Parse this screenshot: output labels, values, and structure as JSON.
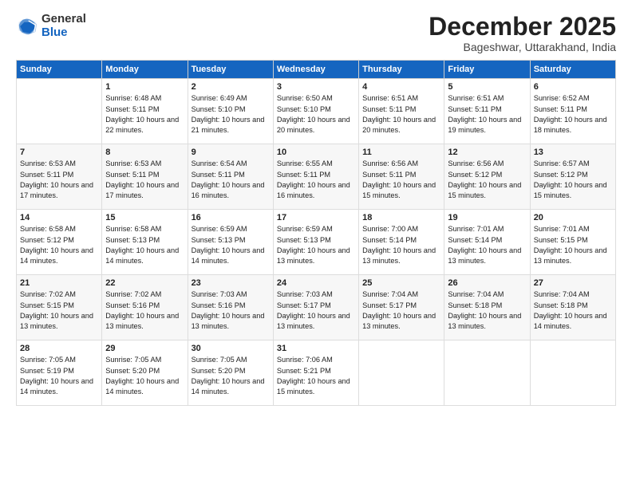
{
  "logo": {
    "general": "General",
    "blue": "Blue"
  },
  "header": {
    "title": "December 2025",
    "subtitle": "Bageshwar, Uttarakhand, India"
  },
  "days_of_week": [
    "Sunday",
    "Monday",
    "Tuesday",
    "Wednesday",
    "Thursday",
    "Friday",
    "Saturday"
  ],
  "weeks": [
    [
      {
        "day": "",
        "sunrise": "",
        "sunset": "",
        "daylight": "",
        "empty": true
      },
      {
        "day": "1",
        "sunrise": "Sunrise: 6:48 AM",
        "sunset": "Sunset: 5:11 PM",
        "daylight": "Daylight: 10 hours and 22 minutes."
      },
      {
        "day": "2",
        "sunrise": "Sunrise: 6:49 AM",
        "sunset": "Sunset: 5:10 PM",
        "daylight": "Daylight: 10 hours and 21 minutes."
      },
      {
        "day": "3",
        "sunrise": "Sunrise: 6:50 AM",
        "sunset": "Sunset: 5:10 PM",
        "daylight": "Daylight: 10 hours and 20 minutes."
      },
      {
        "day": "4",
        "sunrise": "Sunrise: 6:51 AM",
        "sunset": "Sunset: 5:11 PM",
        "daylight": "Daylight: 10 hours and 20 minutes."
      },
      {
        "day": "5",
        "sunrise": "Sunrise: 6:51 AM",
        "sunset": "Sunset: 5:11 PM",
        "daylight": "Daylight: 10 hours and 19 minutes."
      },
      {
        "day": "6",
        "sunrise": "Sunrise: 6:52 AM",
        "sunset": "Sunset: 5:11 PM",
        "daylight": "Daylight: 10 hours and 18 minutes."
      }
    ],
    [
      {
        "day": "7",
        "sunrise": "Sunrise: 6:53 AM",
        "sunset": "Sunset: 5:11 PM",
        "daylight": "Daylight: 10 hours and 17 minutes."
      },
      {
        "day": "8",
        "sunrise": "Sunrise: 6:53 AM",
        "sunset": "Sunset: 5:11 PM",
        "daylight": "Daylight: 10 hours and 17 minutes."
      },
      {
        "day": "9",
        "sunrise": "Sunrise: 6:54 AM",
        "sunset": "Sunset: 5:11 PM",
        "daylight": "Daylight: 10 hours and 16 minutes."
      },
      {
        "day": "10",
        "sunrise": "Sunrise: 6:55 AM",
        "sunset": "Sunset: 5:11 PM",
        "daylight": "Daylight: 10 hours and 16 minutes."
      },
      {
        "day": "11",
        "sunrise": "Sunrise: 6:56 AM",
        "sunset": "Sunset: 5:11 PM",
        "daylight": "Daylight: 10 hours and 15 minutes."
      },
      {
        "day": "12",
        "sunrise": "Sunrise: 6:56 AM",
        "sunset": "Sunset: 5:12 PM",
        "daylight": "Daylight: 10 hours and 15 minutes."
      },
      {
        "day": "13",
        "sunrise": "Sunrise: 6:57 AM",
        "sunset": "Sunset: 5:12 PM",
        "daylight": "Daylight: 10 hours and 15 minutes."
      }
    ],
    [
      {
        "day": "14",
        "sunrise": "Sunrise: 6:58 AM",
        "sunset": "Sunset: 5:12 PM",
        "daylight": "Daylight: 10 hours and 14 minutes."
      },
      {
        "day": "15",
        "sunrise": "Sunrise: 6:58 AM",
        "sunset": "Sunset: 5:13 PM",
        "daylight": "Daylight: 10 hours and 14 minutes."
      },
      {
        "day": "16",
        "sunrise": "Sunrise: 6:59 AM",
        "sunset": "Sunset: 5:13 PM",
        "daylight": "Daylight: 10 hours and 14 minutes."
      },
      {
        "day": "17",
        "sunrise": "Sunrise: 6:59 AM",
        "sunset": "Sunset: 5:13 PM",
        "daylight": "Daylight: 10 hours and 13 minutes."
      },
      {
        "day": "18",
        "sunrise": "Sunrise: 7:00 AM",
        "sunset": "Sunset: 5:14 PM",
        "daylight": "Daylight: 10 hours and 13 minutes."
      },
      {
        "day": "19",
        "sunrise": "Sunrise: 7:01 AM",
        "sunset": "Sunset: 5:14 PM",
        "daylight": "Daylight: 10 hours and 13 minutes."
      },
      {
        "day": "20",
        "sunrise": "Sunrise: 7:01 AM",
        "sunset": "Sunset: 5:15 PM",
        "daylight": "Daylight: 10 hours and 13 minutes."
      }
    ],
    [
      {
        "day": "21",
        "sunrise": "Sunrise: 7:02 AM",
        "sunset": "Sunset: 5:15 PM",
        "daylight": "Daylight: 10 hours and 13 minutes."
      },
      {
        "day": "22",
        "sunrise": "Sunrise: 7:02 AM",
        "sunset": "Sunset: 5:16 PM",
        "daylight": "Daylight: 10 hours and 13 minutes."
      },
      {
        "day": "23",
        "sunrise": "Sunrise: 7:03 AM",
        "sunset": "Sunset: 5:16 PM",
        "daylight": "Daylight: 10 hours and 13 minutes."
      },
      {
        "day": "24",
        "sunrise": "Sunrise: 7:03 AM",
        "sunset": "Sunset: 5:17 PM",
        "daylight": "Daylight: 10 hours and 13 minutes."
      },
      {
        "day": "25",
        "sunrise": "Sunrise: 7:04 AM",
        "sunset": "Sunset: 5:17 PM",
        "daylight": "Daylight: 10 hours and 13 minutes."
      },
      {
        "day": "26",
        "sunrise": "Sunrise: 7:04 AM",
        "sunset": "Sunset: 5:18 PM",
        "daylight": "Daylight: 10 hours and 13 minutes."
      },
      {
        "day": "27",
        "sunrise": "Sunrise: 7:04 AM",
        "sunset": "Sunset: 5:18 PM",
        "daylight": "Daylight: 10 hours and 14 minutes."
      }
    ],
    [
      {
        "day": "28",
        "sunrise": "Sunrise: 7:05 AM",
        "sunset": "Sunset: 5:19 PM",
        "daylight": "Daylight: 10 hours and 14 minutes."
      },
      {
        "day": "29",
        "sunrise": "Sunrise: 7:05 AM",
        "sunset": "Sunset: 5:20 PM",
        "daylight": "Daylight: 10 hours and 14 minutes."
      },
      {
        "day": "30",
        "sunrise": "Sunrise: 7:05 AM",
        "sunset": "Sunset: 5:20 PM",
        "daylight": "Daylight: 10 hours and 14 minutes."
      },
      {
        "day": "31",
        "sunrise": "Sunrise: 7:06 AM",
        "sunset": "Sunset: 5:21 PM",
        "daylight": "Daylight: 10 hours and 15 minutes."
      },
      {
        "day": "",
        "empty": true
      },
      {
        "day": "",
        "empty": true
      },
      {
        "day": "",
        "empty": true
      }
    ]
  ]
}
